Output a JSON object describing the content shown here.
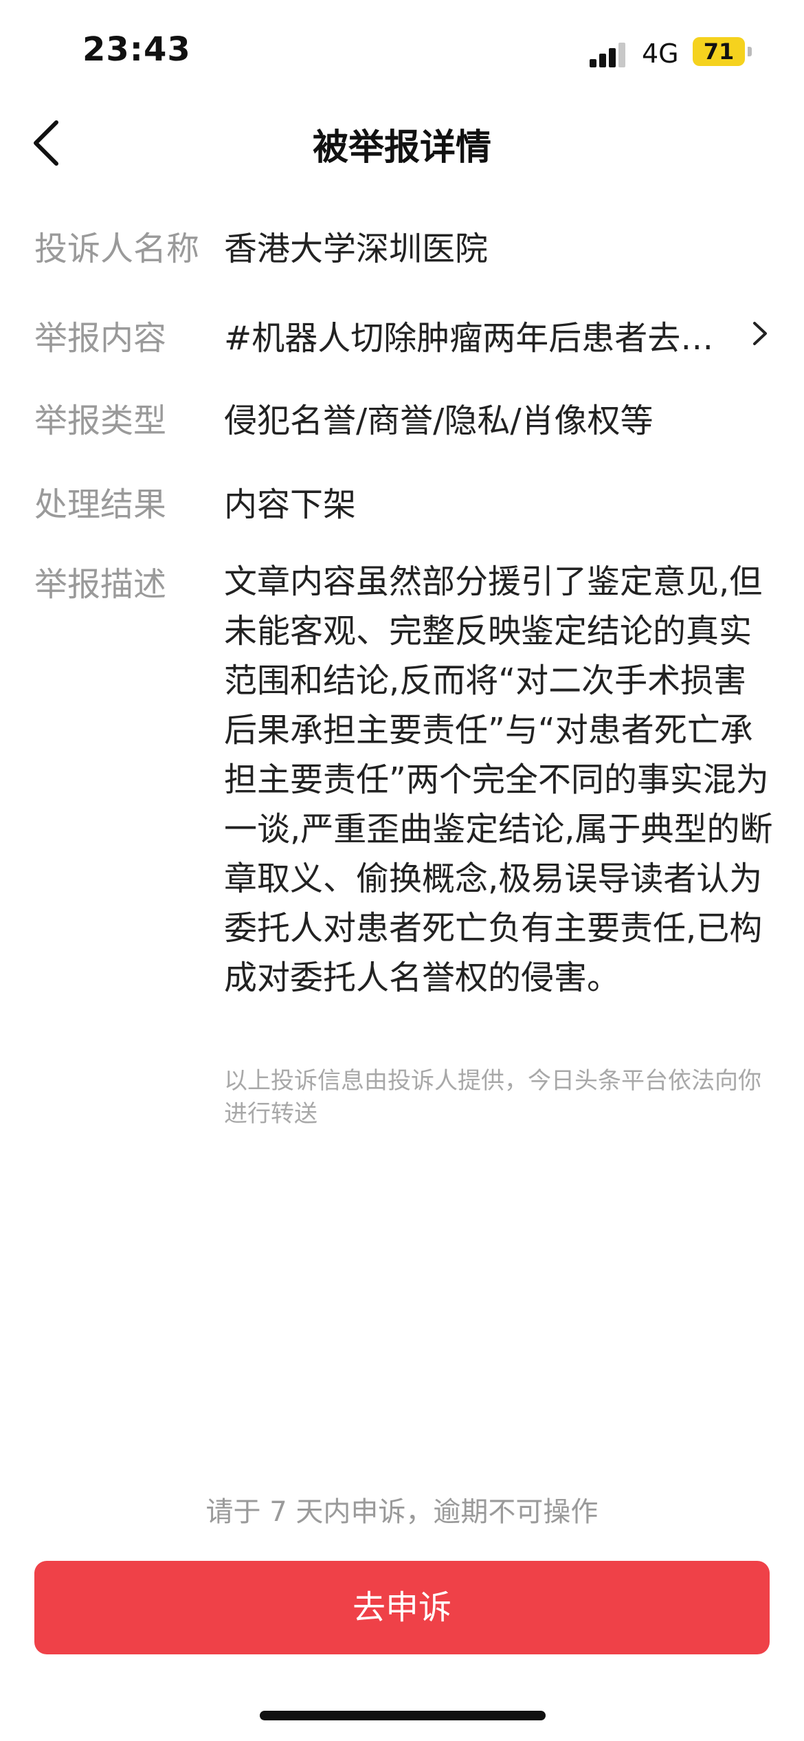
{
  "status_bar": {
    "time": "23:43",
    "network": "4G",
    "battery": "71",
    "battery_color": "#f5d21e"
  },
  "header": {
    "title": "被举报详情",
    "back_icon": "chevron-left-icon"
  },
  "details": {
    "complainant": {
      "label": "投诉人名称",
      "value": "香港大学深圳医院"
    },
    "content": {
      "label": "举报内容",
      "value": "#机器人切除肿瘤两年后患者去…",
      "icon": "chevron-right-icon"
    },
    "type": {
      "label": "举报类型",
      "value": "侵犯名誉/商誉/隐私/肖像权等"
    },
    "result": {
      "label": "处理结果",
      "value": "内容下架"
    },
    "description": {
      "label": "举报描述",
      "value": "文章内容虽然部分援引了鉴定意见,但未能客观、完整反映鉴定结论的真实范围和结论,反而将“对二次手术损害后果承担主要责任”与“对患者死亡承担主要责任”两个完全不同的事实混为一谈,严重歪曲鉴定结论,属于典型的断章取义、偷换概念,极易误导读者认为委托人对患者死亡负有主要责任,已构成对委托人名誉权的侵害。"
    },
    "notice": "以上投诉信息由投诉人提供，今日头条平台依法向你进行转送"
  },
  "footer": {
    "deadline_text": "请于 7 天内申诉，逾期不可操作",
    "appeal_button": "去申诉",
    "accent_color": "#ef4148"
  }
}
